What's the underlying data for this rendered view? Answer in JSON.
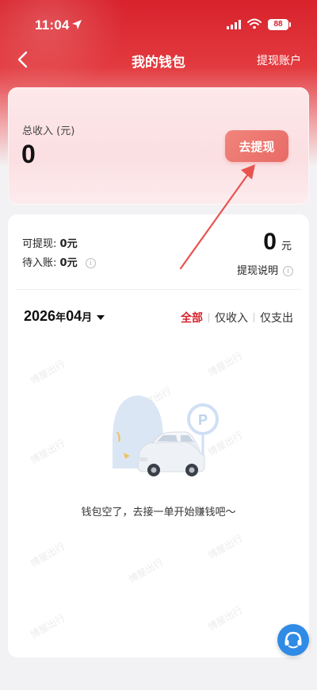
{
  "status_bar": {
    "time": "11:04",
    "battery": "88"
  },
  "nav": {
    "title": "我的钱包",
    "right_link": "提现账户"
  },
  "income_card": {
    "label": "总收入 (元)",
    "value": "0",
    "withdraw_button": "去提现"
  },
  "balance": {
    "withdrawable_label": "可提现:",
    "withdrawable_value": "0元",
    "pending_label": "待入账:",
    "pending_value": "0元",
    "amount": "0",
    "amount_unit": "元",
    "note": "提现说明"
  },
  "month_picker": {
    "year_month": "2026",
    "year_unit": "年",
    "month": "04",
    "month_unit": "月"
  },
  "filters": [
    {
      "label": "全部",
      "active": true
    },
    {
      "label": "仅收入",
      "active": false
    },
    {
      "label": "仅支出",
      "active": false
    }
  ],
  "empty_state": {
    "message": "钱包空了，去接一单开始赚钱吧～"
  },
  "watermark": "博屋出行",
  "colors": {
    "brand_red": "#d8222c",
    "support_blue": "#2f8be6",
    "button_coral": "#ec7470"
  },
  "icons": {
    "back": "chevron-left-icon",
    "location": "location-arrow-icon",
    "signal": "signal-icon",
    "wifi": "wifi-icon",
    "info": "info-icon",
    "support": "customer-service-icon",
    "empty": "empty-wallet-car-illustration"
  }
}
